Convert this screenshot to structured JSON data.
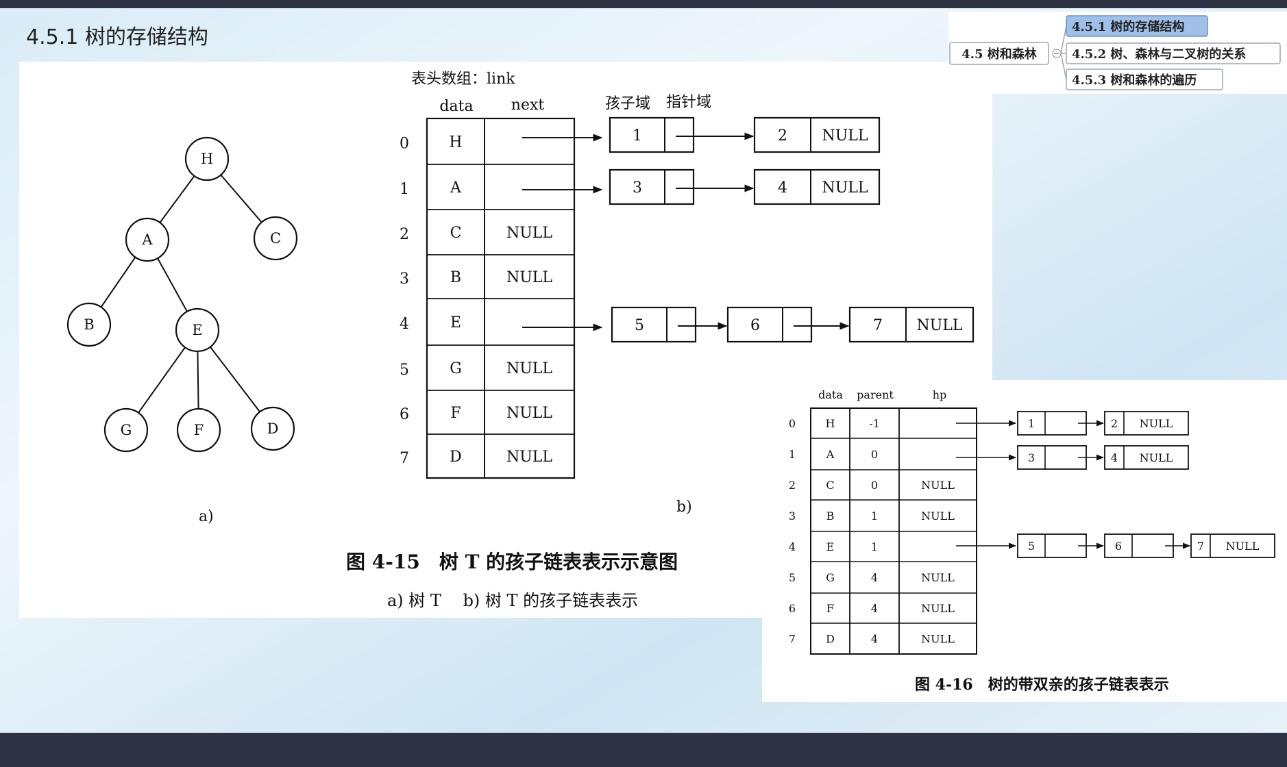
{
  "slide": {
    "title": "4.5.1 树的存储结构"
  },
  "nav": {
    "parent": "4.5 树和森林",
    "items": [
      "4.5.1 树的存储结构",
      "4.5.2 树、森林与二叉树的关系",
      "4.5.3 树和森林的遍历"
    ],
    "active_index": 0
  },
  "fig15": {
    "tree": {
      "nodes": [
        "H",
        "A",
        "C",
        "B",
        "E",
        "G",
        "F",
        "D"
      ],
      "edges": [
        [
          "H",
          "A"
        ],
        [
          "H",
          "C"
        ],
        [
          "A",
          "B"
        ],
        [
          "A",
          "E"
        ],
        [
          "E",
          "G"
        ],
        [
          "E",
          "F"
        ],
        [
          "E",
          "D"
        ]
      ],
      "label": "a)"
    },
    "array": {
      "title": "表头数组：link",
      "col_data": "data",
      "col_next": "next",
      "indices": [
        "0",
        "1",
        "2",
        "3",
        "4",
        "5",
        "6",
        "7"
      ],
      "data": [
        "H",
        "A",
        "C",
        "B",
        "E",
        "G",
        "F",
        "D"
      ],
      "next": [
        "",
        "",
        "NULL",
        "NULL",
        "",
        "NULL",
        "NULL",
        "NULL"
      ]
    },
    "child_field": "孩子域",
    "pointer_field": "指针域",
    "lists": [
      {
        "row": 0,
        "nodes": [
          "1",
          "2"
        ],
        "end": "NULL"
      },
      {
        "row": 1,
        "nodes": [
          "3",
          "4"
        ],
        "end": "NULL"
      },
      {
        "row": 4,
        "nodes": [
          "5",
          "6",
          "7"
        ],
        "end": "NULL"
      }
    ],
    "label_b": "b)",
    "caption": "图 4-15　树 T 的孩子链表表示示意图",
    "subcaption": "a) 树 T　 b) 树 T 的孩子链表表示"
  },
  "fig16": {
    "col_data": "data",
    "col_parent": "parent",
    "col_hp": "hp",
    "indices": [
      "0",
      "1",
      "2",
      "3",
      "4",
      "5",
      "6",
      "7"
    ],
    "data": [
      "H",
      "A",
      "C",
      "B",
      "E",
      "G",
      "F",
      "D"
    ],
    "parent": [
      "-1",
      "0",
      "0",
      "1",
      "1",
      "4",
      "4",
      "4"
    ],
    "hp": [
      "",
      "",
      "NULL",
      "NULL",
      "",
      "NULL",
      "NULL",
      "NULL"
    ],
    "lists": [
      {
        "row": 0,
        "nodes": [
          "1",
          "2"
        ],
        "end": "NULL"
      },
      {
        "row": 1,
        "nodes": [
          "3",
          "4"
        ],
        "end": "NULL"
      },
      {
        "row": 4,
        "nodes": [
          "5",
          "6",
          "7"
        ],
        "end": "NULL"
      }
    ],
    "caption": "图 4-16　树的带双亲的孩子链表表示"
  }
}
